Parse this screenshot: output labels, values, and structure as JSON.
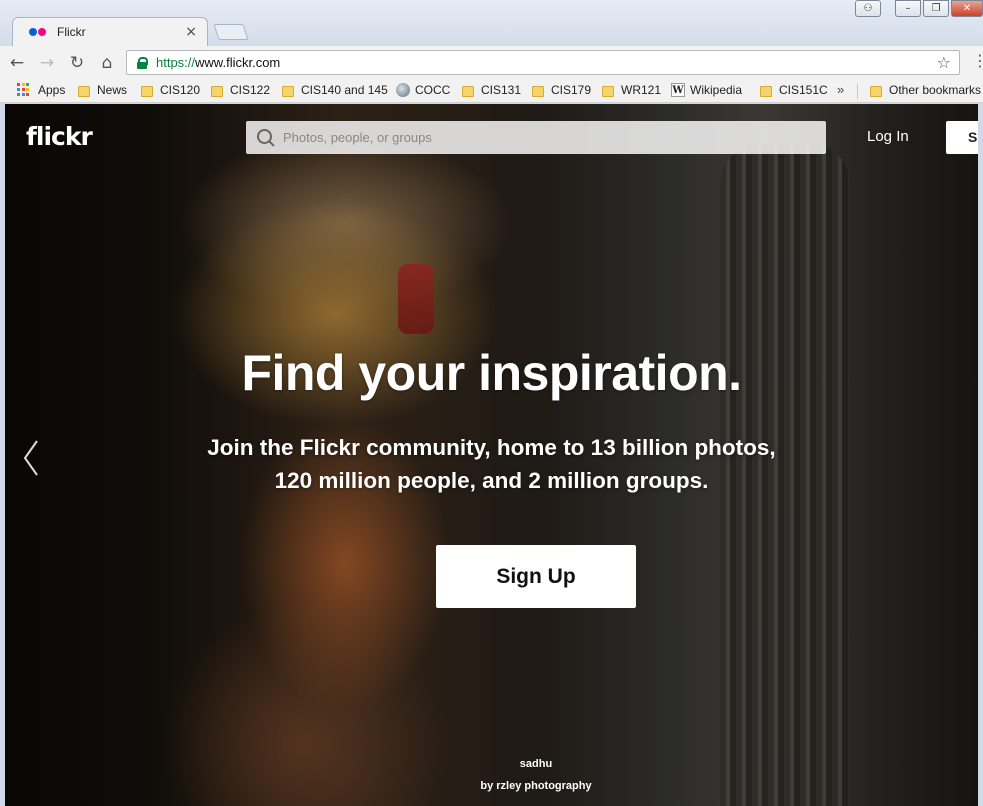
{
  "browser": {
    "tab": {
      "title": "Flickr",
      "close": "×"
    },
    "window_controls": {
      "user": "⚇",
      "minimize": "–",
      "maximize": "❐",
      "close": "✕"
    },
    "toolbar": {
      "back": "←",
      "forward": "→",
      "reload": "↻",
      "home": "⌂",
      "url_scheme": "https://",
      "url_host": "www.flickr.com",
      "star": "☆",
      "menu": "⋮"
    },
    "bookmarks": [
      {
        "label": "Apps",
        "icon": "apps-icon"
      },
      {
        "label": "News",
        "icon": "folder-icon"
      },
      {
        "label": "CIS120",
        "icon": "folder-icon"
      },
      {
        "label": "CIS122",
        "icon": "folder-icon"
      },
      {
        "label": "CIS140 and 145",
        "icon": "folder-icon"
      },
      {
        "label": "COCC",
        "icon": "cocc-icon"
      },
      {
        "label": "CIS131",
        "icon": "folder-icon"
      },
      {
        "label": "CIS179",
        "icon": "folder-icon"
      },
      {
        "label": "WR121",
        "icon": "folder-icon"
      },
      {
        "label": "Wikipedia",
        "icon": "wikipedia-icon"
      },
      {
        "label": "CIS151C",
        "icon": "folder-icon"
      }
    ],
    "bookmarks_more": "»",
    "other_bookmarks": "Other bookmarks"
  },
  "page": {
    "logo": "flickr",
    "search_placeholder": "Photos, people, or groups",
    "login": "Log In",
    "signup_top": "Si",
    "hero_title": "Find your inspiration.",
    "hero_sub_line1": "Join the Flickr community, home to 13 billion photos,",
    "hero_sub_line2": "120 million people, and 2 million groups.",
    "signup_cta": "Sign Up",
    "photo_title": "sadhu",
    "photo_credit": "by rzley photography"
  },
  "colors": {
    "flickr_blue": "#0063dc",
    "flickr_pink": "#ff0084",
    "secure_green": "#0b8043",
    "folder_yellow": "#f5d46e"
  }
}
